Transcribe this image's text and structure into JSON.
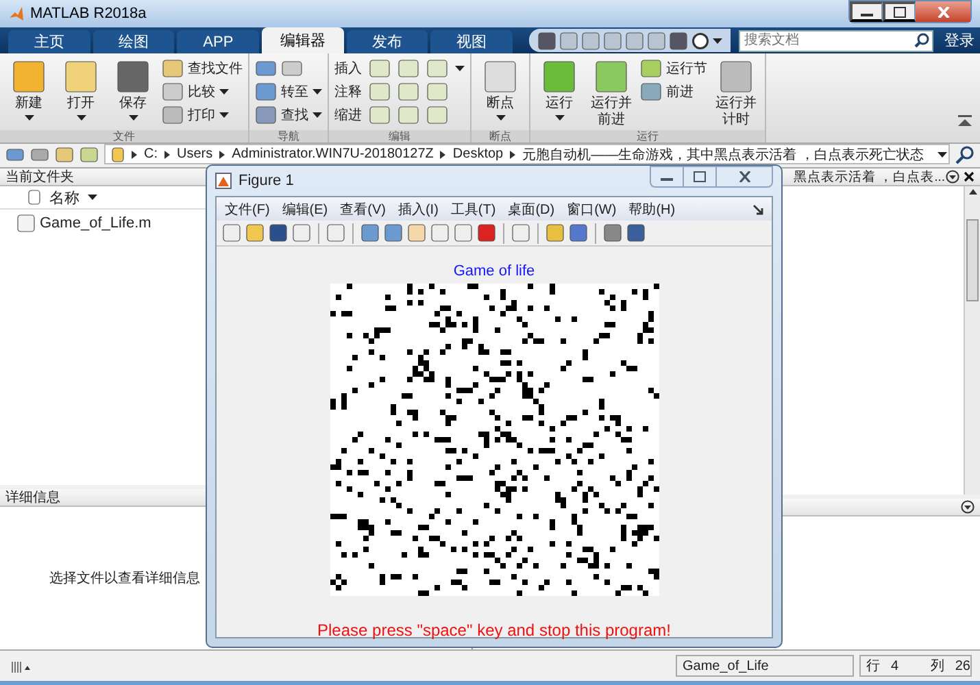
{
  "window": {
    "title": "MATLAB R2018a"
  },
  "tabs": [
    {
      "label": "主页",
      "selected": false
    },
    {
      "label": "绘图",
      "selected": false
    },
    {
      "label": "APP",
      "selected": false
    },
    {
      "label": "编辑器",
      "selected": true
    },
    {
      "label": "发布",
      "selected": false
    },
    {
      "label": "视图",
      "selected": false
    }
  ],
  "search": {
    "placeholder": "搜索文档"
  },
  "sign_in": "登录",
  "ribbon": {
    "groups": [
      {
        "label": "文件",
        "tools": [
          {
            "label": "新建",
            "kind": "large",
            "menu": true
          },
          {
            "label": "打开",
            "kind": "large",
            "menu": true
          },
          {
            "label": "保存",
            "kind": "large",
            "menu": true
          },
          {
            "label": "查找文件",
            "kind": "small",
            "menu": false
          },
          {
            "label": "比较",
            "kind": "small",
            "menu": true
          },
          {
            "label": "打印",
            "kind": "small",
            "menu": true
          }
        ]
      },
      {
        "label": "导航",
        "tools": [
          {
            "label": "转至",
            "kind": "small",
            "menu": true
          },
          {
            "label": "查找",
            "kind": "small",
            "menu": true
          }
        ]
      },
      {
        "label": "编辑",
        "tools": [
          {
            "label": "插入",
            "kind": "row",
            "menu": true
          },
          {
            "label": "注释",
            "kind": "row",
            "menu": false
          },
          {
            "label": "缩进",
            "kind": "row",
            "menu": false
          }
        ]
      },
      {
        "label": "断点",
        "tools": [
          {
            "label": "断点",
            "kind": "large",
            "menu": true
          }
        ]
      },
      {
        "label": "运行",
        "tools": [
          {
            "label": "运行",
            "kind": "large",
            "menu": true
          },
          {
            "label": "运行并前进",
            "kind": "large",
            "menu": false
          },
          {
            "label": "运行节",
            "kind": "small",
            "menu": false
          },
          {
            "label": "前进",
            "kind": "small",
            "menu": false
          },
          {
            "label": "运行并计时",
            "kind": "large",
            "menu": false
          }
        ]
      }
    ]
  },
  "address": {
    "segments": [
      "C:",
      "Users",
      "Administrator.WIN7U-20180127Z",
      "Desktop",
      "元胞自动机——生命游戏，其中黑点表示活着 ，白点表示死亡状态"
    ]
  },
  "current_folder": {
    "title": "当前文件夹",
    "column": "名称",
    "files": [
      "Game_of_Life.m"
    ]
  },
  "details": {
    "title": "详细信息",
    "message": "选择文件以查看详细信息"
  },
  "editor": {
    "title": "黑点表示活着 ，白点表..."
  },
  "figure": {
    "title": "Figure 1",
    "menu": [
      "文件(F)",
      "编辑(E)",
      "查看(V)",
      "插入(I)",
      "工具(T)",
      "桌面(D)",
      "窗口(W)",
      "帮助(H)"
    ],
    "axes_title": "Game of life",
    "message": "Please press \"space\" key and stop this program!"
  },
  "status_bar": {
    "file": "Game_of_Life",
    "line_label": "行",
    "line": "4",
    "column_label": "列",
    "column": "26"
  }
}
